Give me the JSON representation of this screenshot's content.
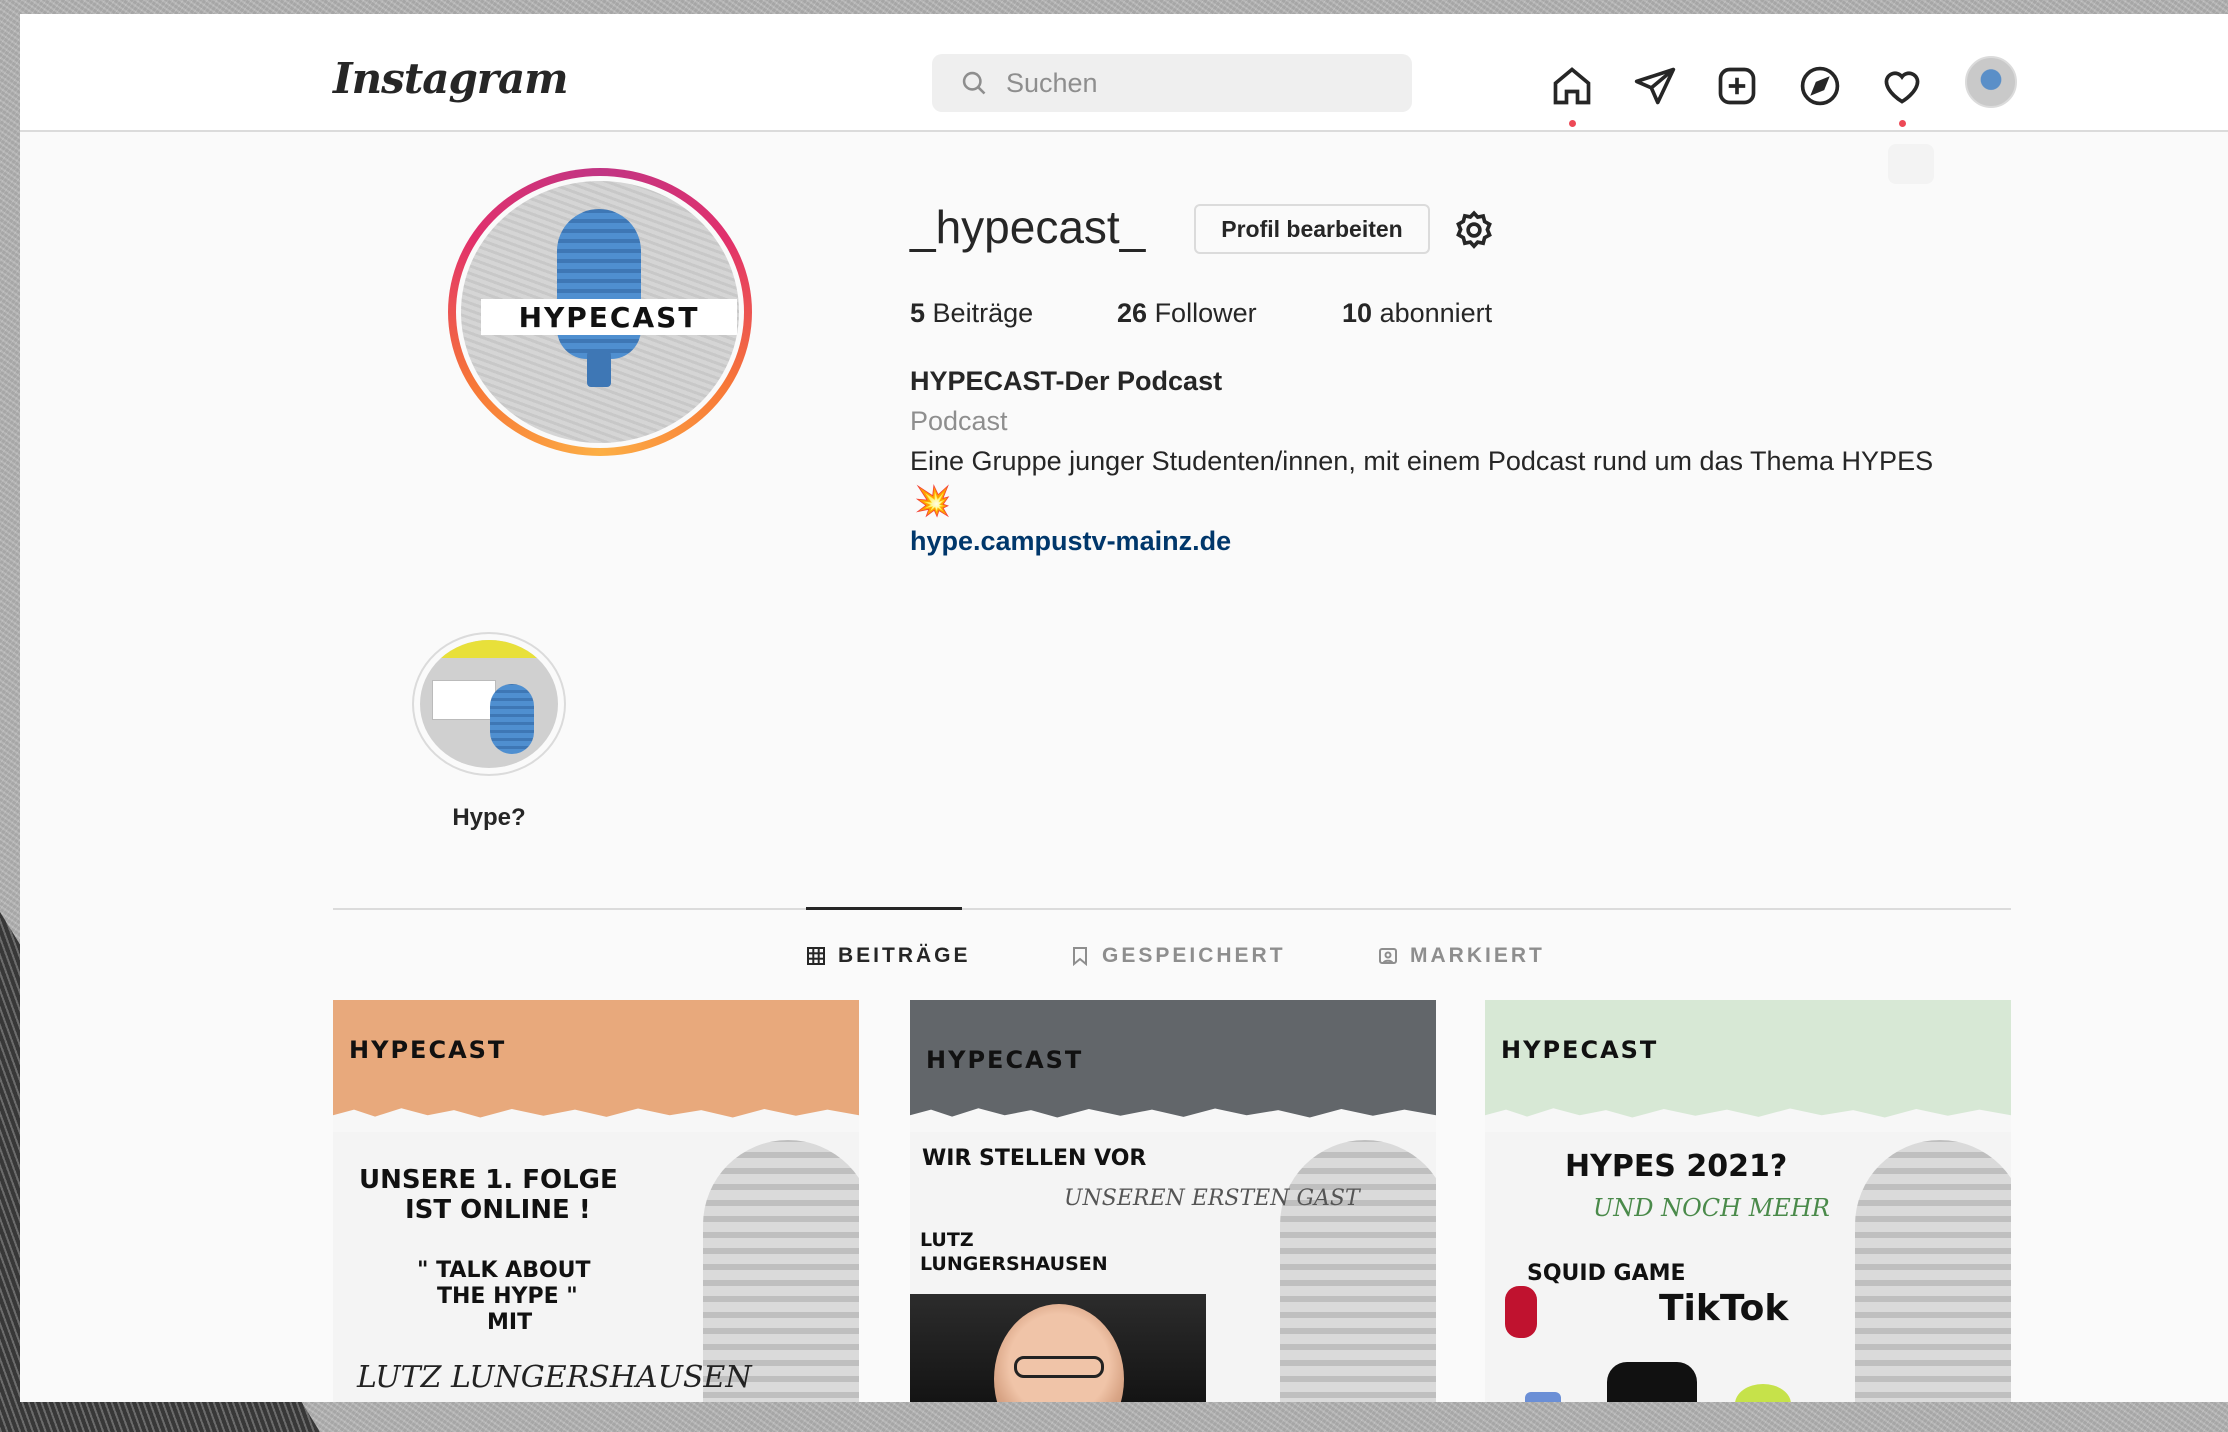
{
  "app": {
    "logo": "Instagram"
  },
  "search": {
    "placeholder": "Suchen"
  },
  "nav": {
    "icons": [
      "home-icon",
      "direct-icon",
      "new-post-icon",
      "explore-icon",
      "activity-icon",
      "avatar"
    ]
  },
  "profile": {
    "username": "_hypecast_",
    "edit_label": "Profil bearbeiten",
    "pic_text": "HYPECAST",
    "stats": {
      "posts_count": "5",
      "posts_label": "Beiträge",
      "followers_count": "26",
      "followers_label": "Follower",
      "following_count": "10",
      "following_label": "abonniert"
    },
    "full_name": "HYPECAST-Der Podcast",
    "category": "Podcast",
    "bio": "Eine Gruppe junger Studenten/innen, mit einem Podcast rund um das Thema HYPES",
    "bio_emoji": "💥",
    "link": "hype.campustv-mainz.de"
  },
  "highlights": [
    {
      "label": "Hype?"
    }
  ],
  "tabs": [
    {
      "label": "BEITRÄGE",
      "active": true
    },
    {
      "label": "GESPEICHERT",
      "active": false
    },
    {
      "label": "MARKIERT",
      "active": false
    }
  ],
  "posts": [
    {
      "brand": "HYPECAST",
      "head_color": "#e8a97c",
      "line1": "UNSERE 1. FOLGE",
      "line2": "IST ONLINE !",
      "line3": "\" TALK ABOUT",
      "line4": "THE HYPE \"",
      "line5": "MIT",
      "hand": "LUTZ LUNGERSHAUSEN"
    },
    {
      "brand": "HYPECAST",
      "head_color": "#62666a",
      "line1": "WIR STELLEN VOR",
      "hand": "UNSEREN ERSTEN GAST",
      "line2": "LUTZ",
      "line3": "LUNGERSHAUSEN"
    },
    {
      "brand": "HYPECAST",
      "head_color": "#d7e8d5",
      "line1": "HYPES 2021?",
      "hand": "UND NOCH MEHR",
      "squid": "SQUID GAME",
      "tiktok": "TikTok"
    }
  ]
}
